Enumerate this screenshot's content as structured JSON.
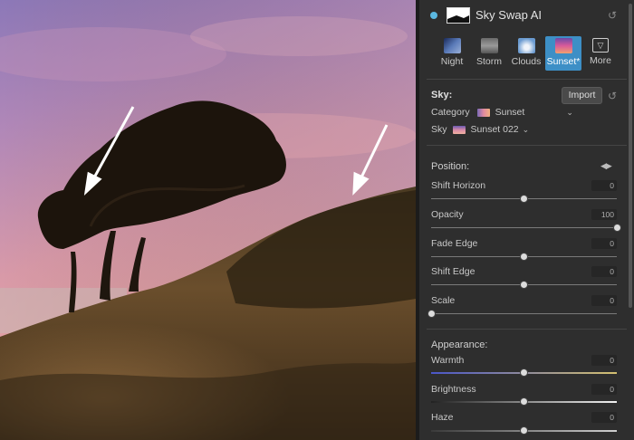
{
  "panel": {
    "title": "Sky Swap AI",
    "presets": [
      {
        "label": "Night",
        "selected": false
      },
      {
        "label": "Storm",
        "selected": false
      },
      {
        "label": "Clouds",
        "selected": false
      },
      {
        "label": "Sunset*",
        "selected": true
      },
      {
        "label": "More",
        "selected": false
      }
    ],
    "sky_section": {
      "heading": "Sky:",
      "import_label": "Import",
      "category_label": "Category",
      "category_value": "Sunset",
      "sky_label": "Sky",
      "sky_value": "Sunset 022"
    },
    "position": {
      "heading": "Position:",
      "sliders": [
        {
          "label": "Shift Horizon",
          "value": "0",
          "level": 0.5
        },
        {
          "label": "Opacity",
          "value": "100",
          "level": 1.0
        },
        {
          "label": "Fade Edge",
          "value": "0",
          "level": 0.5
        },
        {
          "label": "Shift Edge",
          "value": "0",
          "level": 0.5
        },
        {
          "label": "Scale",
          "value": "0",
          "level": 0.0
        }
      ]
    },
    "appearance": {
      "heading": "Appearance:",
      "sliders": [
        {
          "label": "Warmth",
          "value": "0",
          "level": 0.5
        },
        {
          "label": "Brightness",
          "value": "0",
          "level": 0.5
        },
        {
          "label": "Haze",
          "value": "0",
          "level": 0.5
        }
      ]
    }
  },
  "colors": {
    "accent": "#3d8fc6",
    "status_dot": "#5bb8e0",
    "panel_bg": "#2e2e2e"
  },
  "icons": {
    "reset": "reset-icon",
    "dropdown": "chevron-down-icon",
    "more": "chevron-down-box-icon",
    "position_arrows": "left-right-arrows-icon"
  }
}
